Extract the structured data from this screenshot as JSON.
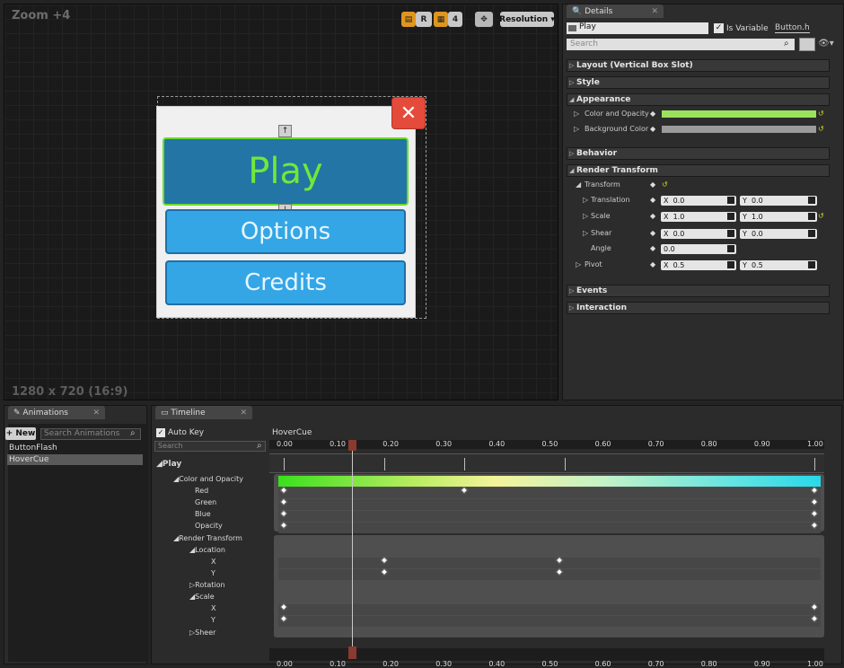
{
  "viewport": {
    "zoom": "Zoom +4",
    "resolution_label": "1280 x 720 (16:9)",
    "toolbar": {
      "r": "R",
      "grid_size": "4",
      "resolution": "Resolution"
    },
    "buttons": {
      "close": "✕",
      "play": "Play",
      "options": "Options",
      "credits": "Credits"
    },
    "arrows": {
      "up": "↑",
      "down": "↓"
    }
  },
  "details": {
    "tab": "Details",
    "name": "Play",
    "is_variable_label": "Is Variable",
    "class_link": "Button.h",
    "search_placeholder": "Search",
    "categories": {
      "layout": "Layout (Vertical Box Slot)",
      "style": "Style",
      "appearance": "Appearance",
      "behavior": "Behavior",
      "render_transform": "Render Transform",
      "events": "Events",
      "interaction": "Interaction"
    },
    "appearance": {
      "color_opacity": "Color and Opacity",
      "background_color": "Background Color",
      "color_opacity_hex": "#9ae25b",
      "background_hex": "#9b9b9b"
    },
    "transform": {
      "transform": "Transform",
      "translation": "Translation",
      "translation_x": "0.0",
      "translation_y": "0.0",
      "scale": "Scale",
      "scale_x": "1.0",
      "scale_y": "1.0",
      "shear": "Shear",
      "shear_x": "0.0",
      "shear_y": "0.0",
      "angle": "Angle",
      "angle_val": "0.0",
      "pivot": "Pivot",
      "pivot_x": "0.5",
      "pivot_y": "0.5",
      "x": "X",
      "y": "Y"
    }
  },
  "animations": {
    "tab": "Animations",
    "new": "New",
    "search_placeholder": "Search Animations",
    "items": [
      "ButtonFlash",
      "HoverCue"
    ]
  },
  "timeline": {
    "tab": "Timeline",
    "auto_key": "Auto Key",
    "search_placeholder": "Search",
    "current_animation": "HoverCue",
    "ruler": [
      "0.00",
      "0.10",
      "0.20",
      "0.30",
      "0.40",
      "0.50",
      "0.60",
      "0.70",
      "0.80",
      "0.90",
      "1.00"
    ],
    "tracks": {
      "play": "Play",
      "color_opacity": "Color and Opacity",
      "red": "Red",
      "green": "Green",
      "blue": "Blue",
      "opacity": "Opacity",
      "render_transform": "Render Transform",
      "location": "Location",
      "x": "X",
      "y": "Y",
      "rotation": "Rotation",
      "scale": "Scale",
      "sx": "X",
      "sy": "Y",
      "sheer": "Sheer"
    }
  }
}
